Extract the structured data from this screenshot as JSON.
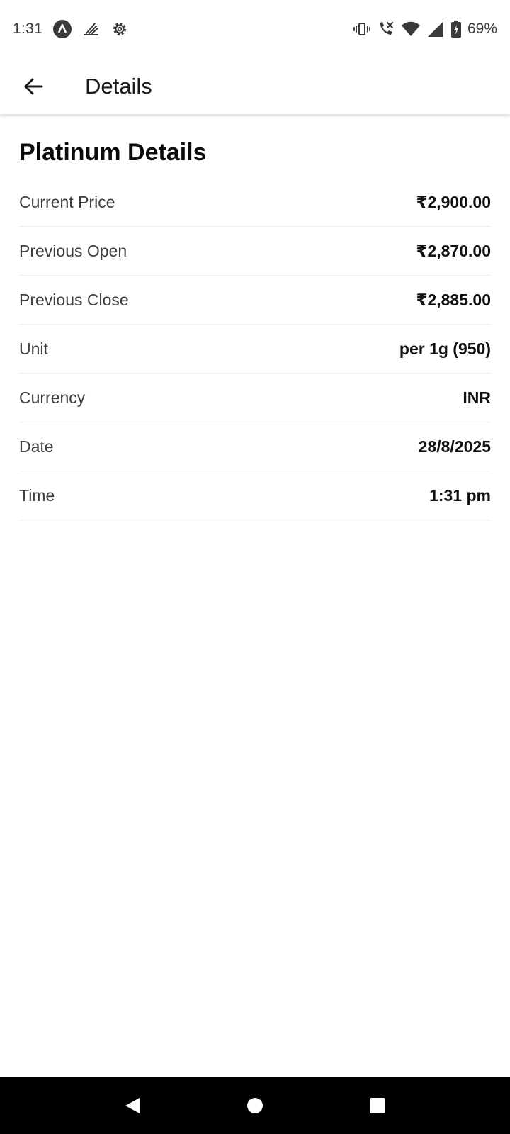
{
  "status_bar": {
    "time": "1:31",
    "battery": "69%",
    "left_icons": [
      "app-notification-icon",
      "app-shortcut-icon",
      "settings-icon"
    ],
    "right_icons": [
      "vibrate-icon",
      "wifi-calling-icon",
      "wifi-icon",
      "cell-signal-icon",
      "battery-charging-icon"
    ]
  },
  "app_bar": {
    "title": "Details",
    "back_icon": "arrow-back-icon"
  },
  "main": {
    "heading": "Platinum Details",
    "rows": [
      {
        "label": "Current Price",
        "value": "₹2,900.00"
      },
      {
        "label": "Previous Open",
        "value": "₹2,870.00"
      },
      {
        "label": "Previous Close",
        "value": "₹2,885.00"
      },
      {
        "label": "Unit",
        "value": "per 1g (950)"
      },
      {
        "label": "Currency",
        "value": "INR"
      },
      {
        "label": "Date",
        "value": "28/8/2025"
      },
      {
        "label": "Time",
        "value": "1:31 pm"
      }
    ]
  },
  "nav_bar": {
    "icons": [
      "nav-back-icon",
      "nav-home-icon",
      "nav-recents-icon"
    ]
  },
  "colors": {
    "text_primary": "#111111",
    "text_secondary": "#3d3d3d",
    "divider": "#eeeeee",
    "nav_background": "#000000"
  }
}
